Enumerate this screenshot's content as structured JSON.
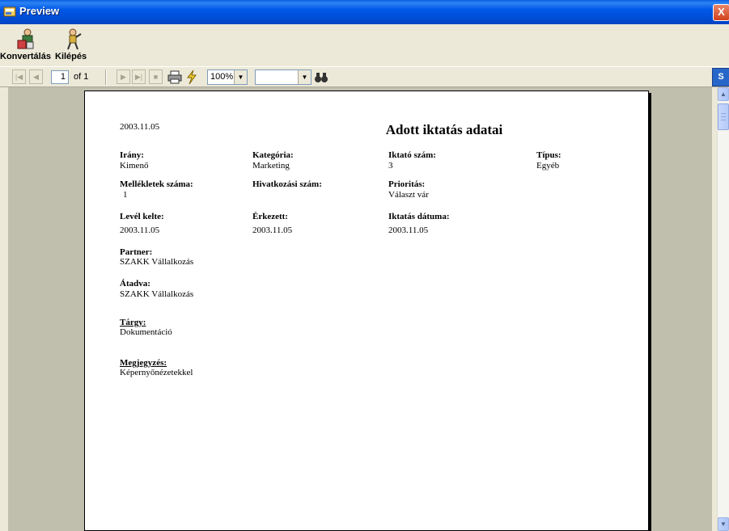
{
  "window": {
    "title": "Preview",
    "close_label": "X"
  },
  "toolbar": {
    "convert_label": "Konvertálás",
    "exit_label": "Kilépés"
  },
  "nav": {
    "current_page": "1",
    "of_label": "of 1",
    "zoom": "100%",
    "search_value": ""
  },
  "document": {
    "print_date": "2003.11.05",
    "title": "Adott iktatás adatai",
    "fields": {
      "irany_label": "Irány:",
      "irany_value": "Kimenő",
      "kategoria_label": "Kategória:",
      "kategoria_value": "Marketing",
      "iktato_szam_label": "Iktató szám:",
      "iktato_szam_value": "3",
      "tipus_label": "Típus:",
      "tipus_value": "Egyéb",
      "mellekletek_label": "Mellékletek száma:",
      "mellekletek_value": "1",
      "hivatkozasi_label": "Hivatkozási szám:",
      "hivatkozasi_value": "",
      "prioritas_label": "Prioritás:",
      "prioritas_value": "Választ vár",
      "level_kelte_label": "Levél kelte:",
      "level_kelte_value": "2003.11.05",
      "erkezett_label": "Érkezett:",
      "erkezett_value": "2003.11.05",
      "iktatas_datuma_label": "Iktatás dátuma:",
      "iktatas_datuma_value": "2003.11.05",
      "partner_label": "Partner:",
      "partner_value": "SZAKK Vállalkozás",
      "atadva_label": "Átadva:",
      "atadva_value": "SZAKK Vállalkozás",
      "targy_label": "Tárgy:",
      "targy_value": "Dokumentáció",
      "megjegyzes_label": "Megjegyzés:",
      "megjegyzes_value": "Képernyőnézetekkel"
    }
  },
  "colors": {
    "titlebar": "#0057e7",
    "workspace": "#c0bfae",
    "chrome": "#ece9d8"
  }
}
